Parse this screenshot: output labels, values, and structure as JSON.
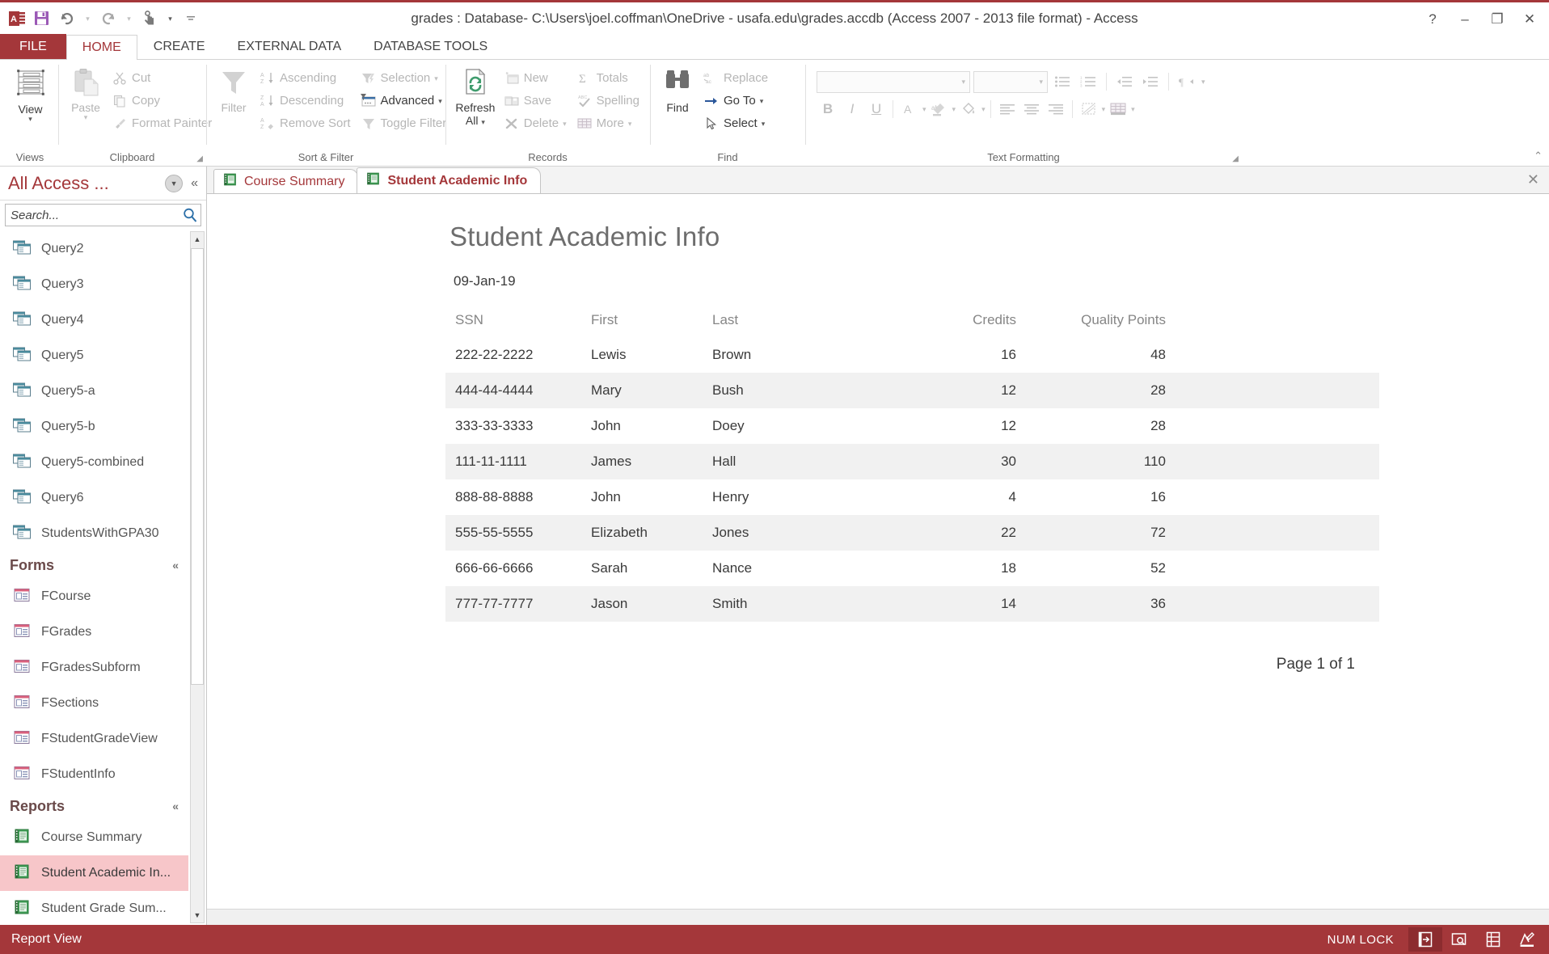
{
  "window": {
    "title": "grades : Database- C:\\Users\\joel.coffman\\OneDrive - usafa.edu\\grades.accdb (Access 2007 - 2013 file format) - Access",
    "help_label": "?",
    "minimize_label": "–",
    "restore_label": "❐",
    "close_label": "✕"
  },
  "quick_access": {
    "app_icon": "access-icon",
    "save": "save-icon",
    "undo": "undo-icon",
    "redo": "redo-icon",
    "touch_mode": "touch-mode-icon",
    "customize": "customize-qat-icon"
  },
  "ribbon": {
    "file_tab": "FILE",
    "tabs": [
      {
        "label": "HOME",
        "active": true
      },
      {
        "label": "CREATE",
        "active": false
      },
      {
        "label": "EXTERNAL DATA",
        "active": false
      },
      {
        "label": "DATABASE TOOLS",
        "active": false
      }
    ],
    "groups": {
      "views": {
        "label": "Views",
        "view_button": "View"
      },
      "clipboard": {
        "label": "Clipboard",
        "paste": "Paste",
        "cut": "Cut",
        "copy": "Copy",
        "format_painter": "Format Painter"
      },
      "sort_filter": {
        "label": "Sort & Filter",
        "filter": "Filter",
        "ascending": "Ascending",
        "descending": "Descending",
        "remove_sort": "Remove Sort",
        "selection": "Selection",
        "advanced": "Advanced",
        "toggle_filter": "Toggle Filter"
      },
      "records": {
        "label": "Records",
        "refresh_all_line1": "Refresh",
        "refresh_all_line2": "All",
        "new": "New",
        "save": "Save",
        "delete": "Delete",
        "totals": "Totals",
        "spelling": "Spelling",
        "more": "More"
      },
      "find": {
        "label": "Find",
        "find": "Find",
        "replace": "Replace",
        "go_to": "Go To",
        "select": "Select"
      },
      "text_formatting": {
        "label": "Text Formatting",
        "font_family_value": "",
        "font_size_value": "",
        "bold": "B",
        "italic": "I",
        "underline": "U"
      }
    },
    "collapse_label": "⌃"
  },
  "nav_pane": {
    "title": "All Access ...",
    "dropdown_icon": "chevron-down-circle-icon",
    "collapse_icon": "double-chevron-left-icon",
    "search_placeholder": "Search...",
    "search_value": "",
    "search_icon": "search-icon",
    "items": [
      {
        "label": "Query2",
        "type": "query",
        "selected": false
      },
      {
        "label": "Query3",
        "type": "query",
        "selected": false
      },
      {
        "label": "Query4",
        "type": "query",
        "selected": false
      },
      {
        "label": "Query5",
        "type": "query",
        "selected": false
      },
      {
        "label": "Query5-a",
        "type": "query",
        "selected": false
      },
      {
        "label": "Query5-b",
        "type": "query",
        "selected": false
      },
      {
        "label": "Query5-combined",
        "type": "query",
        "selected": false
      },
      {
        "label": "Query6",
        "type": "query",
        "selected": false
      },
      {
        "label": "StudentsWithGPA30",
        "type": "query",
        "selected": false
      }
    ],
    "forms_group": {
      "label": "Forms",
      "chevron": "«"
    },
    "forms": [
      {
        "label": "FCourse",
        "type": "form",
        "selected": false
      },
      {
        "label": "FGrades",
        "type": "form",
        "selected": false
      },
      {
        "label": "FGradesSubform",
        "type": "form",
        "selected": false
      },
      {
        "label": "FSections",
        "type": "form",
        "selected": false
      },
      {
        "label": "FStudentGradeView",
        "type": "form",
        "selected": false
      },
      {
        "label": "FStudentInfo",
        "type": "form",
        "selected": false
      }
    ],
    "reports_group": {
      "label": "Reports",
      "chevron": "«"
    },
    "reports": [
      {
        "label": "Course Summary",
        "type": "report",
        "selected": false
      },
      {
        "label": "Student Academic In...",
        "type": "report",
        "selected": true
      },
      {
        "label": "Student Grade Sum...",
        "type": "report",
        "selected": false
      }
    ],
    "scroll_up": "▲",
    "scroll_down": "▼"
  },
  "doc_tabs": [
    {
      "label": "Course Summary",
      "icon": "report-icon",
      "active": false
    },
    {
      "label": "Student Academic Info",
      "icon": "report-icon",
      "active": true
    }
  ],
  "doc_tab_close": "✕",
  "report": {
    "title": "Student Academic Info",
    "date": "09-Jan-19",
    "columns": [
      {
        "key": "ssn",
        "label": "SSN",
        "align": "left"
      },
      {
        "key": "first",
        "label": "First",
        "align": "left"
      },
      {
        "key": "last",
        "label": "Last",
        "align": "left"
      },
      {
        "key": "credits",
        "label": "Credits",
        "align": "right"
      },
      {
        "key": "quality_points",
        "label": "Quality Points",
        "align": "right"
      }
    ],
    "rows": [
      {
        "ssn": "222-22-2222",
        "first": "Lewis",
        "last": "Brown",
        "credits": "16",
        "quality_points": "48"
      },
      {
        "ssn": "444-44-4444",
        "first": "Mary",
        "last": "Bush",
        "credits": "12",
        "quality_points": "28"
      },
      {
        "ssn": "333-33-3333",
        "first": "John",
        "last": "Doey",
        "credits": "12",
        "quality_points": "28"
      },
      {
        "ssn": "111-11-1111",
        "first": "James",
        "last": "Hall",
        "credits": "30",
        "quality_points": "110"
      },
      {
        "ssn": "888-88-8888",
        "first": "John",
        "last": "Henry",
        "credits": "4",
        "quality_points": "16"
      },
      {
        "ssn": "555-55-5555",
        "first": "Elizabeth",
        "last": "Jones",
        "credits": "22",
        "quality_points": "72"
      },
      {
        "ssn": "666-66-6666",
        "first": "Sarah",
        "last": "Nance",
        "credits": "18",
        "quality_points": "52"
      },
      {
        "ssn": "777-77-7777",
        "first": "Jason",
        "last": "Smith",
        "credits": "14",
        "quality_points": "36"
      }
    ],
    "page_footer": "Page 1 of 1"
  },
  "status_bar": {
    "view_label": "Report View",
    "num_lock": "NUM LOCK",
    "views": [
      {
        "name": "report-view-icon",
        "active": true
      },
      {
        "name": "print-preview-icon",
        "active": false
      },
      {
        "name": "layout-view-icon",
        "active": false
      },
      {
        "name": "design-view-icon",
        "active": false
      }
    ]
  },
  "colors": {
    "accent": "#a4373a",
    "accent_dark": "#8c2c2f",
    "selection": "#f7c6c9",
    "alt_row": "#f1f1f1",
    "header_text": "#868686"
  }
}
